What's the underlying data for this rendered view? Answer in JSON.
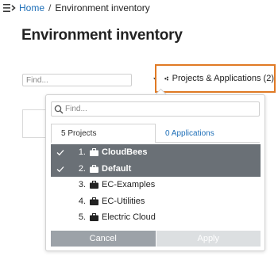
{
  "breadcrumb": {
    "home": "Home",
    "separator": "/",
    "current": "Environment inventory"
  },
  "page": {
    "title": "Environment inventory"
  },
  "filter": {
    "placeholder": "Find..."
  },
  "project_filter_button": {
    "label": "Projects & Applications (2)",
    "icon": "cluster-icon",
    "accent_color": "#e07a25"
  },
  "dropdown": {
    "search_placeholder": "Find...",
    "tabs": {
      "projects": "5 Projects",
      "applications": "0 Applications"
    },
    "items": [
      {
        "num": "1.",
        "name": "CloudBees",
        "selected": true
      },
      {
        "num": "2.",
        "name": "Default",
        "selected": true
      },
      {
        "num": "3.",
        "name": "EC-Examples",
        "selected": false
      },
      {
        "num": "4.",
        "name": "EC-Utilities",
        "selected": false
      },
      {
        "num": "5.",
        "name": "Electric Cloud",
        "selected": false
      }
    ],
    "cancel_label": "Cancel",
    "apply_label": "Apply"
  },
  "colors": {
    "link": "#1e6fb8",
    "selected_row": "#6a7076",
    "cancel_bg": "#9ca2a8",
    "apply_bg": "#dcdfe1"
  }
}
